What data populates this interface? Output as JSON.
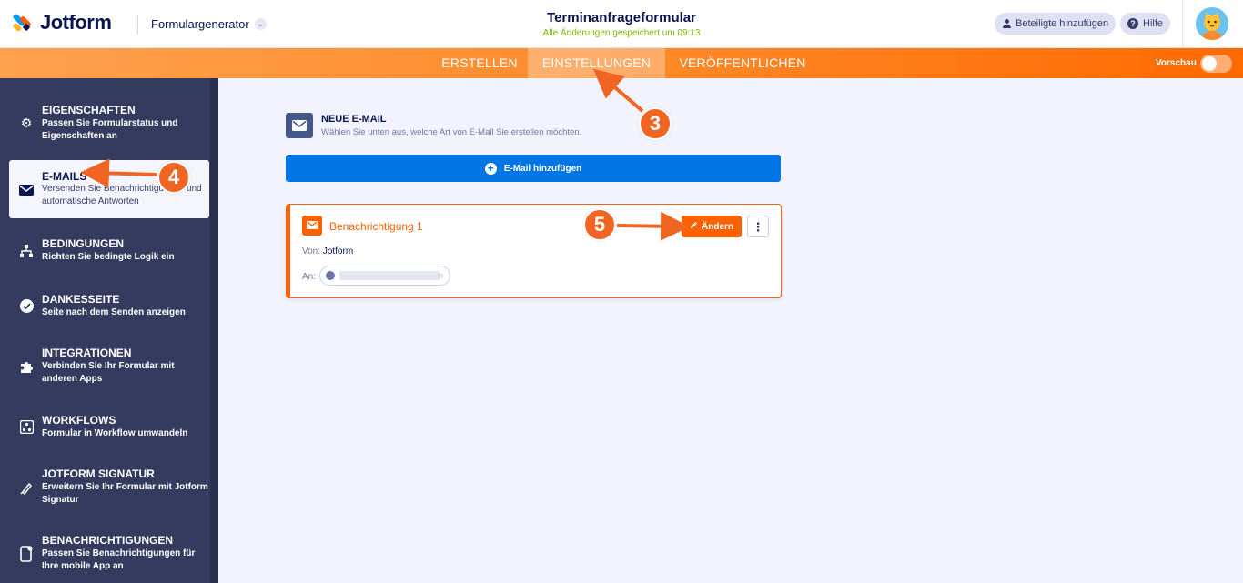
{
  "header": {
    "logo_text": "Jotform",
    "builder_dropdown": "Formulargenerator",
    "form_title": "Terminanfrageformular",
    "save_status": "Alle Änderungen gespeichert um 09:13",
    "participants_btn": "Beteiligte hinzufügen",
    "help_btn": "Hilfe"
  },
  "nav": {
    "tabs": [
      {
        "label": "ERSTELLEN"
      },
      {
        "label": "EINSTELLUNGEN",
        "active": true
      },
      {
        "label": "VERÖFFENTLICHEN"
      }
    ],
    "preview_label": "Vorschau",
    "preview_on": false
  },
  "sidebar": {
    "items": [
      {
        "title": "EIGENSCHAFTEN",
        "desc": "Passen Sie Formularstatus und Eigenschaften an",
        "icon": "gear-icon"
      },
      {
        "title": "E-MAILS",
        "desc": "Versenden Sie Benachrichtigungen und automatische Antworten",
        "icon": "envelope-icon",
        "active": true
      },
      {
        "title": "BEDINGUNGEN",
        "desc": "Richten Sie bedingte Logik ein",
        "icon": "sitemap-icon"
      },
      {
        "title": "DANKESSEITE",
        "desc": "Seite nach dem Senden anzeigen",
        "icon": "check-circle-icon"
      },
      {
        "title": "INTEGRATIONEN",
        "desc": "Verbinden Sie Ihr Formular mit anderen Apps",
        "icon": "puzzle-icon"
      },
      {
        "title": "WORKFLOWS",
        "desc": "Formular in Workflow umwandeln",
        "icon": "workflow-icon"
      },
      {
        "title": "JOTFORM SIGNATUR",
        "desc": "Erweitern Sie Ihr Formular mit Jotform Signatur",
        "icon": "pen-icon"
      },
      {
        "title": "BENACHRICHTIGUNGEN",
        "desc": "Passen Sie Benachrichtigungen für Ihre mobile App an",
        "icon": "mobile-icon"
      }
    ]
  },
  "main": {
    "new_email_title": "NEUE E-MAIL",
    "new_email_sub": "Wählen Sie unten aus, welche Art von E-Mail Sie erstellen möchten.",
    "add_button": "E-Mail hinzufügen",
    "card": {
      "title": "Benachrichtigung 1",
      "edit_button": "Ändern",
      "from_label": "Von:",
      "from_value": "Jotform",
      "to_label": "An:",
      "to_tail": "n"
    }
  },
  "annotations": [
    "3",
    "4",
    "5"
  ],
  "colors": {
    "brand_orange": "#ff6100",
    "nav_gradient_start": "#ffa14e",
    "sidebar_bg": "#343b5e",
    "primary_blue": "#0075e3",
    "save_green": "#78bb07",
    "annotation": "#f16522"
  }
}
